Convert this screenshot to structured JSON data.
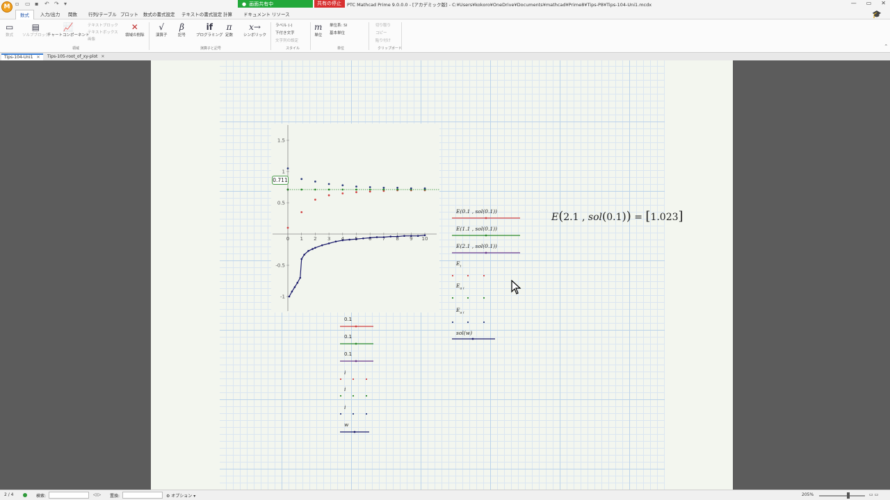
{
  "titlebar": {
    "app_logo": "M",
    "share_label": "画面共有中",
    "share_stop_label": "共有の停止",
    "window_title": "PTC Mathcad Prime 9.0.0.0 - [アカデミック版] - C:¥Users¥kokoro¥OneDrive¥Documents¥mathcad¥Prime8¥Tips-P8¥Tips-104-Uni1.mcdx",
    "controls": [
      "—",
      "▭",
      "✕"
    ]
  },
  "ribbon_tabs": [
    "数式",
    "入力/出力",
    "関数",
    "行列/テーブル",
    "プロット",
    "数式の書式設定",
    "テキストの書式設定",
    "計算",
    "ドキュメント",
    "リソース"
  ],
  "active_tab": "数式",
  "ribbon": {
    "workspace_group": {
      "label": "領域",
      "items": [
        "数式",
        "ソルブブロック",
        "チャートコンポーネント",
        "テキストブロック",
        "テキストボックス",
        "画像",
        "領域の削除"
      ]
    },
    "operators_group": {
      "label": "演算子と記号",
      "items": [
        {
          "glyph": "√",
          "label": "演算子"
        },
        {
          "glyph": "β",
          "label": "記号"
        },
        {
          "glyph": "if",
          "label": "プログラミング"
        },
        {
          "glyph": "π",
          "label": "定数"
        },
        {
          "glyph": "x→",
          "label": "シンボリック"
        }
      ]
    },
    "style_group": {
      "label": "スタイル",
      "items": [
        "ラベル (-)",
        "下付き文字",
        "文字列の設定"
      ]
    },
    "units_group": {
      "label": "単位",
      "glyph": "m",
      "items": [
        "単位",
        "単位系: SI",
        "基本単位"
      ]
    },
    "clipboard_group": {
      "label": "クリップボード",
      "items": [
        "切り取り",
        "コピー",
        "貼り付け"
      ]
    }
  },
  "doc_tabs": [
    "Tips-104-Uni1",
    "Tips-105-root_of_xy-plot"
  ],
  "plot": {
    "cursor_value": "0.711",
    "y_ticks": [
      "1.5",
      "1",
      "0.5",
      "-0.5",
      "-1"
    ],
    "x_ticks": [
      "0",
      "1",
      "2",
      "3",
      "4",
      "5",
      "6",
      "7",
      "8",
      "9",
      "10"
    ],
    "y_traces_legend": [
      {
        "text": "E(0.1 , sol(0.1))",
        "color": "#d04040"
      },
      {
        "text": "E(1.1 , sol(0.1))",
        "color": "#2a8a2a"
      },
      {
        "text": "E(2.1 , sol(0.1))",
        "color": "#6a3a8a"
      },
      {
        "text": "E",
        "sub": "i",
        "color": "#d04040"
      },
      {
        "text": "E",
        "sub": "a i",
        "color": "#2a8a2a"
      },
      {
        "text": "E",
        "sub": "a i",
        "color": "#2a3a7a"
      },
      {
        "text": "sol(w)",
        "color": "#1a1a6a"
      }
    ],
    "x_traces_legend": [
      {
        "text": "0.1",
        "color": "#d04040"
      },
      {
        "text": "0.1",
        "color": "#2a8a2a"
      },
      {
        "text": "0.1",
        "color": "#6a3a8a"
      },
      {
        "text": "i",
        "color": "#d04040"
      },
      {
        "text": "i",
        "color": "#2a8a2a"
      },
      {
        "text": "i",
        "color": "#2a3a7a"
      },
      {
        "text": "w",
        "color": "#1a1a6a"
      }
    ]
  },
  "formula": {
    "lhs_func": "E",
    "arg1": "2.1",
    "arg2_func": "sol",
    "arg2_val": "0.1",
    "result": "1.023"
  },
  "chart_data": {
    "type": "scatter",
    "xlim": [
      0,
      10
    ],
    "ylim": [
      -1,
      1.5
    ],
    "series": [
      {
        "name": "E(0.1 , sol(0.1))",
        "x": [
          0
        ],
        "y": [
          0.711
        ]
      },
      {
        "name": "E(1.1 , sol(0.1))",
        "x": [
          0
        ],
        "y": [
          0.711
        ]
      },
      {
        "name": "E(2.1 , sol(0.1))",
        "x": [
          0
        ],
        "y": [
          0.711
        ]
      },
      {
        "name": "E_i",
        "x": [
          0,
          1,
          2,
          3,
          4,
          5,
          6,
          7,
          8,
          9,
          10
        ],
        "y": [
          0.1,
          0.35,
          0.55,
          0.62,
          0.65,
          0.67,
          0.68,
          0.69,
          0.7,
          0.7,
          0.7
        ]
      },
      {
        "name": "E_a_i (green)",
        "x": [
          0,
          1,
          2,
          3,
          4,
          5,
          6,
          7,
          8,
          9,
          10
        ],
        "y": [
          0.711,
          0.711,
          0.711,
          0.711,
          0.711,
          0.711,
          0.711,
          0.711,
          0.711,
          0.711,
          0.711
        ]
      },
      {
        "name": "E_a_i (navy)",
        "x": [
          0,
          1,
          2,
          3,
          4,
          5,
          6,
          7,
          8,
          9,
          10
        ],
        "y": [
          1.05,
          0.88,
          0.84,
          0.8,
          0.78,
          0.76,
          0.75,
          0.74,
          0.74,
          0.73,
          0.73
        ]
      },
      {
        "name": "sol(w)",
        "x": [
          0.1,
          0.3,
          0.5,
          0.7,
          0.9,
          1.0,
          1.2,
          1.5,
          1.8,
          2.0,
          2.5,
          3.0,
          3.5,
          4.0,
          4.5,
          5.0,
          5.5,
          6.0,
          6.5,
          7.0,
          7.5,
          8.0,
          8.5,
          9.0,
          9.5,
          10.0
        ],
        "y": [
          -1.0,
          -0.92,
          -0.85,
          -0.78,
          -0.7,
          -0.4,
          -0.33,
          -0.27,
          -0.24,
          -0.22,
          -0.18,
          -0.15,
          -0.12,
          -0.1,
          -0.09,
          -0.08,
          -0.07,
          -0.06,
          -0.05,
          -0.05,
          -0.04,
          -0.04,
          -0.03,
          -0.03,
          -0.03,
          -0.02
        ]
      }
    ]
  },
  "statusbar": {
    "page": "2 / 4",
    "search_label": "検索:",
    "replace_label": "置換:",
    "options_label": "オプション",
    "zoom": "205%"
  },
  "colors": {
    "accent": "#3a7fd5",
    "share_green": "#22a83a",
    "stop_red": "#d83030"
  }
}
